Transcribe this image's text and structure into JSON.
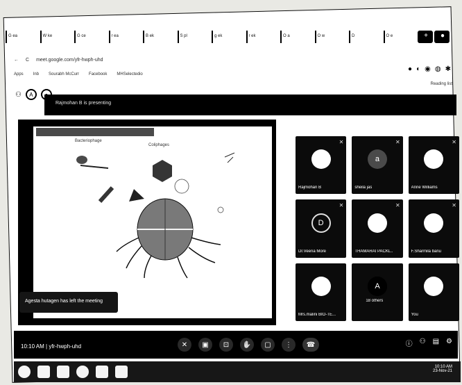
{
  "browser": {
    "tabs": [
      "G ea",
      "W ke",
      "G ce",
      "r ea",
      "B ek",
      "S pl",
      "g ek",
      "r ek",
      "O a",
      "O w",
      "D",
      "O e"
    ],
    "address": "meet.google.com/yfr-hwph-uhd",
    "bookmarks": [
      "Apps",
      "Inb",
      "Sourabh McCurr",
      "Facebook",
      "MHSelectedio"
    ],
    "reading_list": "Reading list"
  },
  "meet": {
    "presenting_banner": "Rajmohan B is presenting",
    "toast": "Agesta hutagen has left the meeting",
    "time": "10:10 AM",
    "meeting_code": "yfr-hwph-uhd",
    "participants": [
      {
        "name": "Rajmohan B",
        "initial": ""
      },
      {
        "name": "sheila jas",
        "initial": "a"
      },
      {
        "name": "Anne Williams",
        "initial": ""
      },
      {
        "name": "Dr.Veena More",
        "initial": "D"
      },
      {
        "name": "THAMARAI PACKL..",
        "initial": ""
      },
      {
        "name": "F.Sharmila banu",
        "initial": ""
      },
      {
        "name": "Mrs.malini BIO-TE...",
        "initial": ""
      },
      {
        "name": "18 others",
        "initial": "A"
      },
      {
        "name": "You",
        "initial": ""
      }
    ],
    "others_count": "18 others"
  },
  "slide": {
    "heading_left": "Bacteriophage",
    "heading_right": "Coliphages"
  },
  "taskbar": {
    "clock_time": "10:10 AM",
    "clock_date": "23-Nov-21"
  }
}
